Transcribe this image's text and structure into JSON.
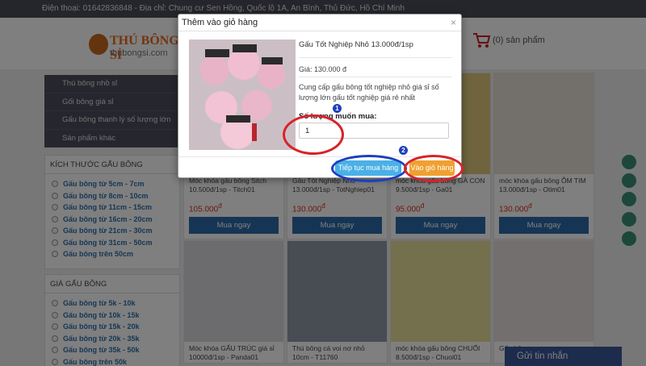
{
  "topbar": {
    "contact": "Điện thoại: 01642836848 - Địa chỉ: Chung cư Sen Hồng, Quốc lộ 1A, An Bình, Thủ Đức, Hồ Chí Minh"
  },
  "header": {
    "logo_main": "THÚ BÔNG SỈ",
    "logo_domain": "thubongsi.com",
    "cart_label": "(0) sản phẩm"
  },
  "sidenav": {
    "items": [
      "Thú bông nhồ sỉ",
      "Gối bông giá sỉ",
      "Gấu bông thanh lý số lượng lớn",
      "Sản phẩm khác"
    ]
  },
  "filters": [
    {
      "title": "Kích thước gấu bông",
      "options": [
        "Gấu bông từ 5cm - 7cm",
        "Gấu bông từ 8cm - 10cm",
        "Gấu bông từ 11cm - 15cm",
        "Gấu bông từ 16cm - 20cm",
        "Gấu bông từ 21cm - 30cm",
        "Gấu bông từ 31cm - 50cm",
        "Gấu bông trên 50cm"
      ]
    },
    {
      "title": "Giá gấu bông",
      "options": [
        "Gấu bông từ 5k - 10k",
        "Gấu bông từ 10k - 15k",
        "Gấu bông từ 15k - 20k",
        "Gấu bông từ 20k - 35k",
        "Gấu bông từ 35k - 50k",
        "Gấu bông trên 50k"
      ]
    }
  ],
  "products": [
    {
      "name": "Móc khóa gấu bông Sitch 10.500đ/1sp - Titch01",
      "price": "105.000",
      "currency": "đ",
      "buy": "Mua ngay",
      "tone": "#d7d2cf"
    },
    {
      "name": "Gấu Tốt Nghiệp Nhỏ 13.000đ/1sp - TotNghiep01",
      "price": "130.000",
      "currency": "đ",
      "buy": "Mua ngay",
      "tone": "#cfc4c8"
    },
    {
      "name": "móc khóa gấu bông GÀ CON 9.500đ/1sp - Ga01",
      "price": "95.000",
      "currency": "đ",
      "buy": "Mua ngay",
      "tone": "#dfc97a"
    },
    {
      "name": "móc khóa gấu bông ÔM TIM 13.000đ/1sp - Otim01",
      "price": "130.000",
      "currency": "đ",
      "buy": "Mua ngay",
      "tone": "#e6dfd4"
    },
    {
      "name": "Móc khóa GẤU TRÚC giá sỉ 10000đ/1sp - Panda01",
      "price": "",
      "currency": "",
      "buy": "",
      "tone": "#d8d8dc"
    },
    {
      "name": "Thú bông cá voi nơ nhỏ 10cm - T11760",
      "price": "",
      "currency": "",
      "buy": "",
      "tone": "#8e9aa6"
    },
    {
      "name": "móc khóa gấu bông CHUỐI 8.500đ/1sp - Chuoi01",
      "price": "",
      "currency": "",
      "buy": "",
      "tone": "#e8df9a"
    },
    {
      "name": "Gấu bông …",
      "price": "",
      "currency": "",
      "buy": "",
      "tone": "#e8dede"
    }
  ],
  "modal": {
    "title": "Thêm vào giỏ hàng",
    "close": "×",
    "product_name": "Gấu Tốt Nghiệp Nhỏ 13.000đ/1sp",
    "price": "Giá: 130.000 đ",
    "description": "Cung cấp gấu bông tốt nghiệp nhỏ giá sỉ số lượng lớn gấu tốt nghiệp giá rẻ nhất",
    "qty_label": "Số lượng muốn mua:",
    "qty_value": "1",
    "continue_button": "Tiếp tục mua hàng",
    "cart_button": "Vào giỏ hàng"
  },
  "annotations": {
    "step1": "1",
    "step2": "2"
  },
  "chat": {
    "label": "Gửi tin nhắn"
  },
  "colors": {
    "accent": "#2c6aa8",
    "price": "#d9301f",
    "continue": "#4ab0e6",
    "cart": "#f0a030",
    "annotation_red": "#d8222a",
    "annotation_blue": "#1d3fbf"
  },
  "icons": [
    "home-icon",
    "lightbulb-icon",
    "search-icon",
    "chat-icon",
    "book-icon",
    "cart-icon"
  ]
}
